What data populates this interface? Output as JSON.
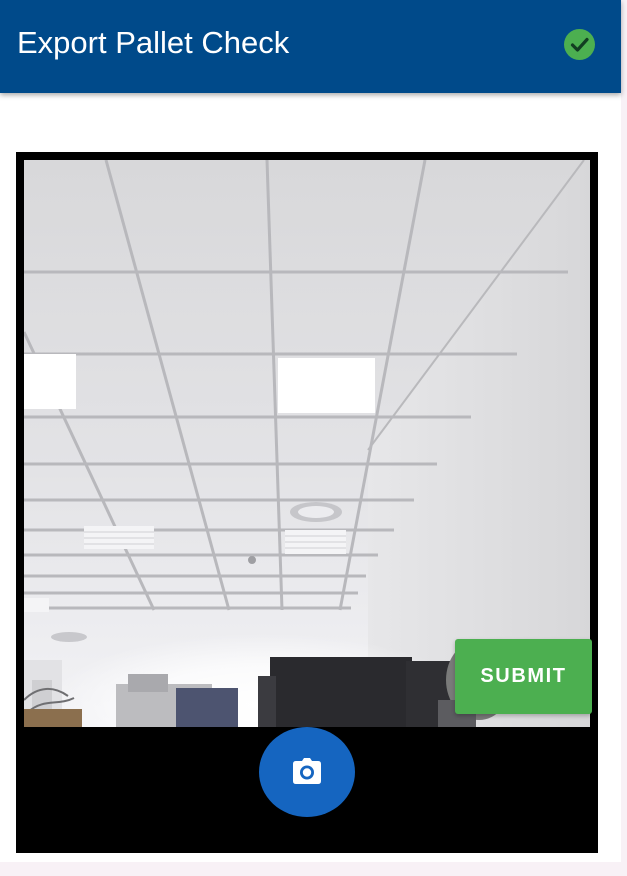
{
  "header": {
    "title": "Export Pallet Check",
    "status_icon": "check-circle-icon",
    "background_color": "#004a8a",
    "status_color": "#4caf50"
  },
  "camera": {
    "feed": "live-camera-preview",
    "capture_icon": "camera-icon",
    "capture_color": "#1565c0"
  },
  "actions": {
    "submit_label": "SUBMIT",
    "submit_color": "#4caf50"
  }
}
